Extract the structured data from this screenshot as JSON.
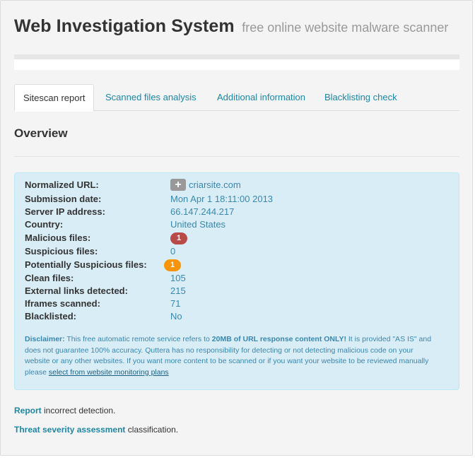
{
  "header": {
    "title": "Web Investigation System",
    "subtitle": "free online website malware scanner"
  },
  "tabs": [
    {
      "label": "Sitescan report",
      "active": true
    },
    {
      "label": "Scanned files analysis",
      "active": false
    },
    {
      "label": "Additional information",
      "active": false
    },
    {
      "label": "Blacklisting check",
      "active": false
    }
  ],
  "overview": {
    "title": "Overview"
  },
  "report": {
    "normalized_url": {
      "label": "Normalized URL:",
      "icon_glyph": "+",
      "value": "criarsite.com"
    },
    "submission_date": {
      "label": "Submission date:",
      "value": "Mon Apr 1 18:11:00 2013"
    },
    "server_ip": {
      "label": "Server IP address:",
      "value": "66.147.244.217"
    },
    "country": {
      "label": "Country:",
      "value": "United States"
    },
    "malicious_files": {
      "label": "Malicious files:",
      "value": "1"
    },
    "suspicious_files": {
      "label": "Suspicious files:",
      "value": "0"
    },
    "potentially_suspicious": {
      "label": "Potentially Suspicious files:",
      "value": "1"
    },
    "clean_files": {
      "label": "Clean files:",
      "value": "105"
    },
    "external_links": {
      "label": "External links detected:",
      "value": "215"
    },
    "iframes": {
      "label": "Iframes scanned:",
      "value": "71"
    },
    "blacklisted": {
      "label": "Blacklisted:",
      "value": "No"
    }
  },
  "disclaimer": {
    "label": "Disclaimer:",
    "text1": " This free automatic remote service refers to ",
    "emphasis": "20MB of URL response content ONLY!",
    "text2": " It is provided \"AS IS\" and does not guarantee 100% accuracy. Quttera has no responsibility for detecting or not detecting malicious code on your website or any other websites. If you want more content to be scanned or if you want your website to be reviewed manually please ",
    "link": "select from website monitoring plans"
  },
  "footer": {
    "report_link": "Report",
    "report_text": " incorrect detection.",
    "threat_link": "Threat severity assessment",
    "threat_text": " classification."
  },
  "colors": {
    "accent": "#1c87a8",
    "info_bg": "#d9edf7",
    "danger_badge": "#b94a48",
    "warning_badge": "#f89406"
  }
}
